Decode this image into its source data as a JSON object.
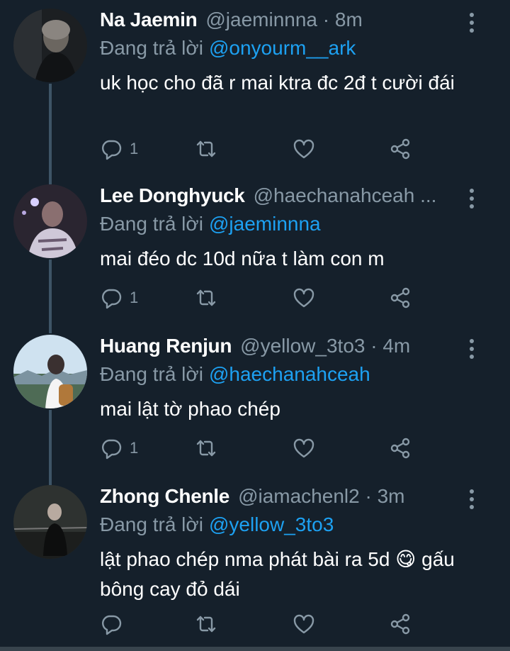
{
  "colors": {
    "background": "#15202b",
    "muted": "#8899a6",
    "accent": "#1da1f2",
    "text": "#ffffff"
  },
  "replying_label": "Đang trả lời",
  "tweets": [
    {
      "name": "Na Jaemin",
      "handle": "@jaeminnna · 8m",
      "reply_to": "@onyourm__ark",
      "text": "uk học cho đã r mai ktra đc 2đ t cười đái",
      "reply_count": "1"
    },
    {
      "name": "Lee Donghyuck",
      "handle": "@haechanahceah ...",
      "reply_to": "@jaeminnna",
      "text": "mai đéo dc 10d nữa t làm con m",
      "reply_count": "1"
    },
    {
      "name": "Huang Renjun",
      "handle": "@yellow_3to3 · 4m",
      "reply_to": "@haechanahceah",
      "text": "mai lật tờ phao chép",
      "reply_count": "1"
    },
    {
      "name": "Zhong Chenle",
      "handle": "@iamachenl2 · 3m",
      "reply_to": "@yellow_3to3",
      "text": "lật phao chép nma phát bài ra 5d 😋 gấu bông cay đỏ dái",
      "reply_count": ""
    }
  ],
  "icons": [
    "reply-icon",
    "retweet-icon",
    "like-icon",
    "share-icon",
    "more-icon"
  ]
}
